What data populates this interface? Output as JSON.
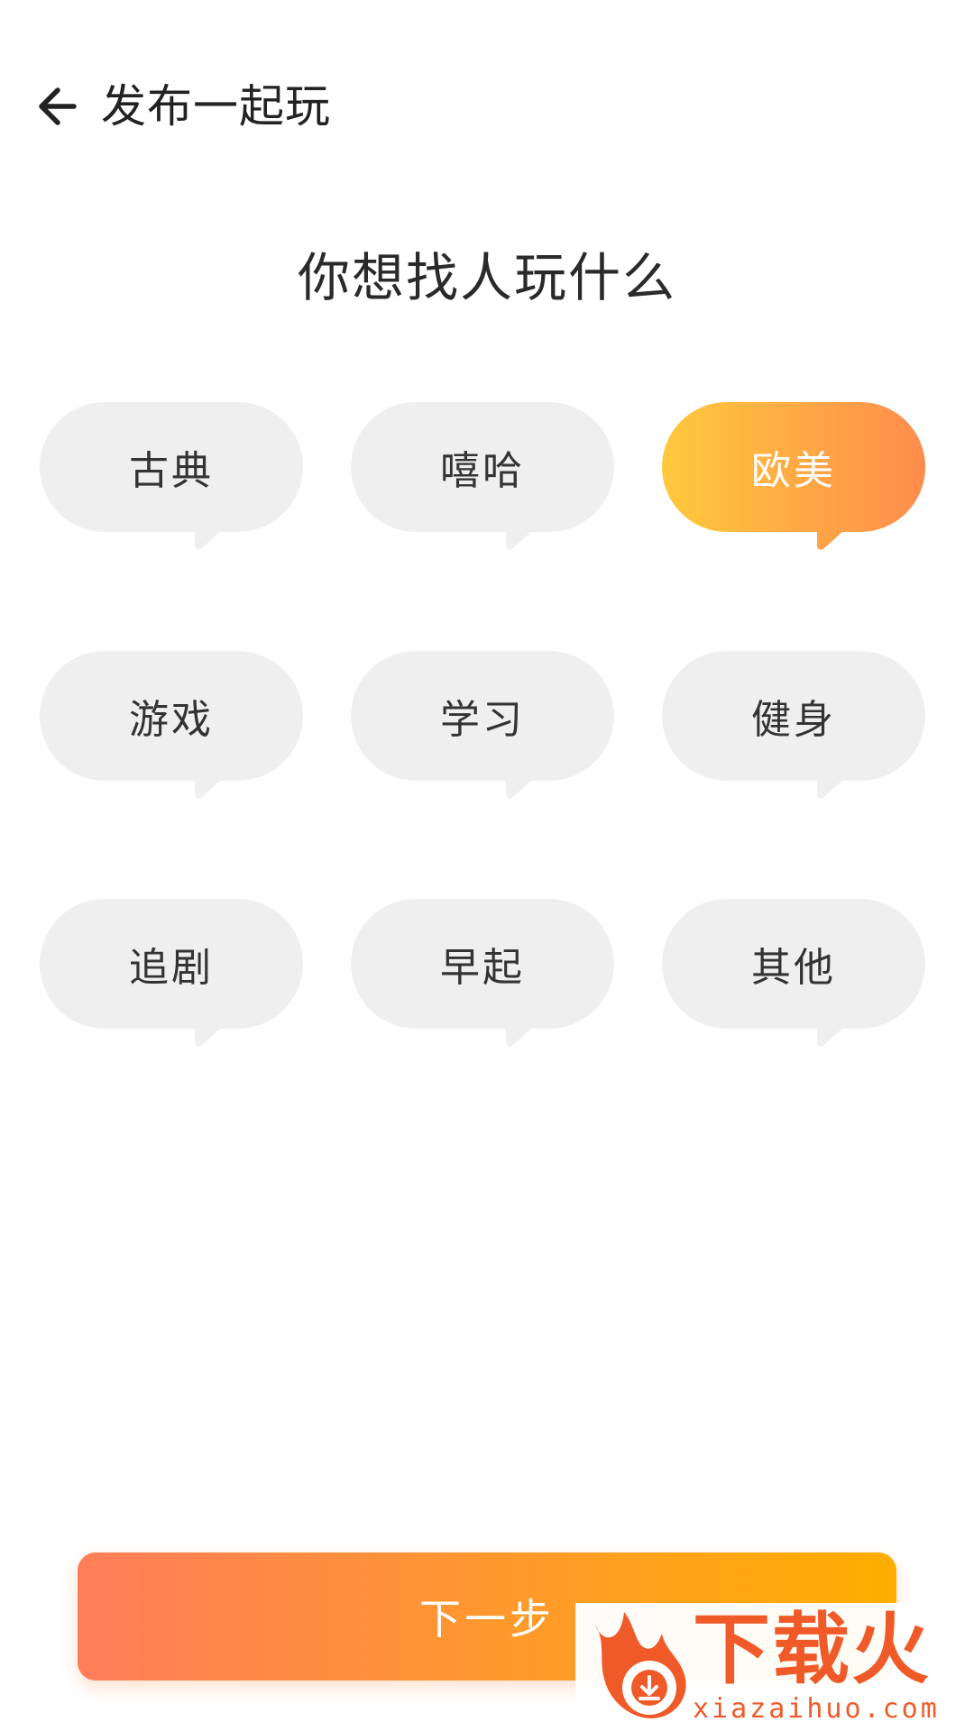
{
  "header": {
    "title": "发布一起玩",
    "back_icon": "arrow-left-icon"
  },
  "prompt": "你想找人玩什么",
  "categories": [
    {
      "label": "古典",
      "selected": false
    },
    {
      "label": "嘻哈",
      "selected": false
    },
    {
      "label": "欧美",
      "selected": true
    },
    {
      "label": "游戏",
      "selected": false
    },
    {
      "label": "学习",
      "selected": false
    },
    {
      "label": "健身",
      "selected": false
    },
    {
      "label": "追剧",
      "selected": false
    },
    {
      "label": "早起",
      "selected": false
    },
    {
      "label": "其他",
      "selected": false
    }
  ],
  "next_button": {
    "label": "下一步"
  },
  "watermark": {
    "brand": "下载火",
    "url": "xiazaihuo.com"
  },
  "colors": {
    "bubble_bg": "#efefef",
    "selected_start": "#ffc93c",
    "selected_end": "#ff8c4c",
    "next_start": "#ff7d5a",
    "next_end": "#ffad00",
    "brand": "#f05a28"
  }
}
